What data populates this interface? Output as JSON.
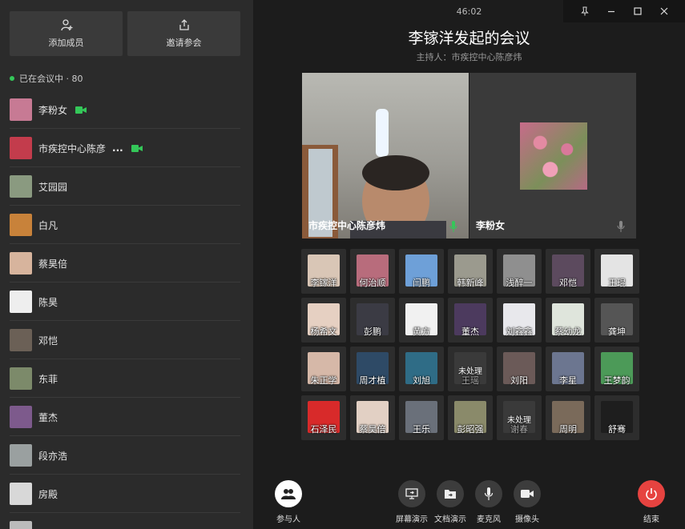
{
  "left": {
    "add_member": "添加成员",
    "invite": "邀请参会",
    "status": "已在会议中 · 80",
    "participants": [
      {
        "name": "李粉女",
        "camera": true,
        "color": "#c77a94"
      },
      {
        "name": "市疾控中心陈彦",
        "more": "...",
        "camera": true,
        "color": "#c33c4c"
      },
      {
        "name": "艾园园",
        "color": "#8a9a80"
      },
      {
        "name": "白凡",
        "color": "#c8823a"
      },
      {
        "name": "蔡昊倍",
        "color": "#d7b49d"
      },
      {
        "name": "陈昊",
        "color": "#eeeeee"
      },
      {
        "name": "邓恺",
        "color": "#6b6056"
      },
      {
        "name": "东菲",
        "color": "#7c8a6a"
      },
      {
        "name": "董杰",
        "color": "#7d5a8c"
      },
      {
        "name": "段亦浩",
        "color": "#9aa0a0"
      },
      {
        "name": "房殿",
        "color": "#d8d8d8"
      },
      {
        "name": "",
        "color": "#bbbbbb"
      }
    ]
  },
  "header": {
    "timer": "46:02",
    "title": "李镓洋发起的会议",
    "host": "主持人：市疾控中心陈彦炜"
  },
  "videos": [
    {
      "name": "市疾控中心陈彦炜",
      "mic_color": "#34c759"
    },
    {
      "name": "李粉女",
      "mic_color": "#888888"
    }
  ],
  "grid": [
    {
      "name": "李镓洋",
      "color": "#d9c6b6"
    },
    {
      "name": "何治顺",
      "color": "#b86c7c"
    },
    {
      "name": "闫鹏",
      "color": "#6ea0d8"
    },
    {
      "name": "韩新峰",
      "color": "#9b9a8e"
    },
    {
      "name": "浅醉一",
      "color": "#8f8f8f"
    },
    {
      "name": "邓恺",
      "color": "#5c4a5e"
    },
    {
      "name": "王琨",
      "color": "#e4e4e4"
    },
    {
      "name": "杨希文",
      "color": "#e6d0c2"
    },
    {
      "name": "彭鹏",
      "color": "#3b3b44"
    },
    {
      "name": "黄方",
      "color": "#f1f1f1"
    },
    {
      "name": "董杰",
      "color": "#4c3a5e"
    },
    {
      "name": "刘鑫鑫",
      "color": "#e8e8ec"
    },
    {
      "name": "蔡幼龙",
      "color": "#dfe5dc"
    },
    {
      "name": "龚坤",
      "color": "#555555"
    },
    {
      "name": "朱正学",
      "color": "#d6b8a8"
    },
    {
      "name": "周才植",
      "color": "#2e4a66"
    },
    {
      "name": "刘旭",
      "color": "#2f6c86"
    },
    {
      "name": "王瑶",
      "status": "未处理",
      "color": "#3a3a3a"
    },
    {
      "name": "刘阳",
      "color": "#6b5a58"
    },
    {
      "name": "李星",
      "color": "#6c7690"
    },
    {
      "name": "王梦韵",
      "color": "#4c9a58"
    },
    {
      "name": "石泽民",
      "color": "#d82a2a"
    },
    {
      "name": "蔡昊倍",
      "color": "#e2d0c4"
    },
    {
      "name": "王乐",
      "color": "#6a707a"
    },
    {
      "name": "彭昭强",
      "color": "#8a8a6a"
    },
    {
      "name": "谢春",
      "status": "未处理",
      "color": "#3a3a3a"
    },
    {
      "name": "周明",
      "color": "#7a6a5a"
    },
    {
      "name": "舒骞",
      "color": "#1e1e1e"
    }
  ],
  "bottom": {
    "participants": "参与人",
    "screen_share": "屏幕演示",
    "doc_share": "文档演示",
    "mic": "麦克风",
    "camera": "摄像头",
    "end": "结束"
  },
  "colors": {
    "accent_green": "#34c759",
    "end_red": "#e64340"
  }
}
